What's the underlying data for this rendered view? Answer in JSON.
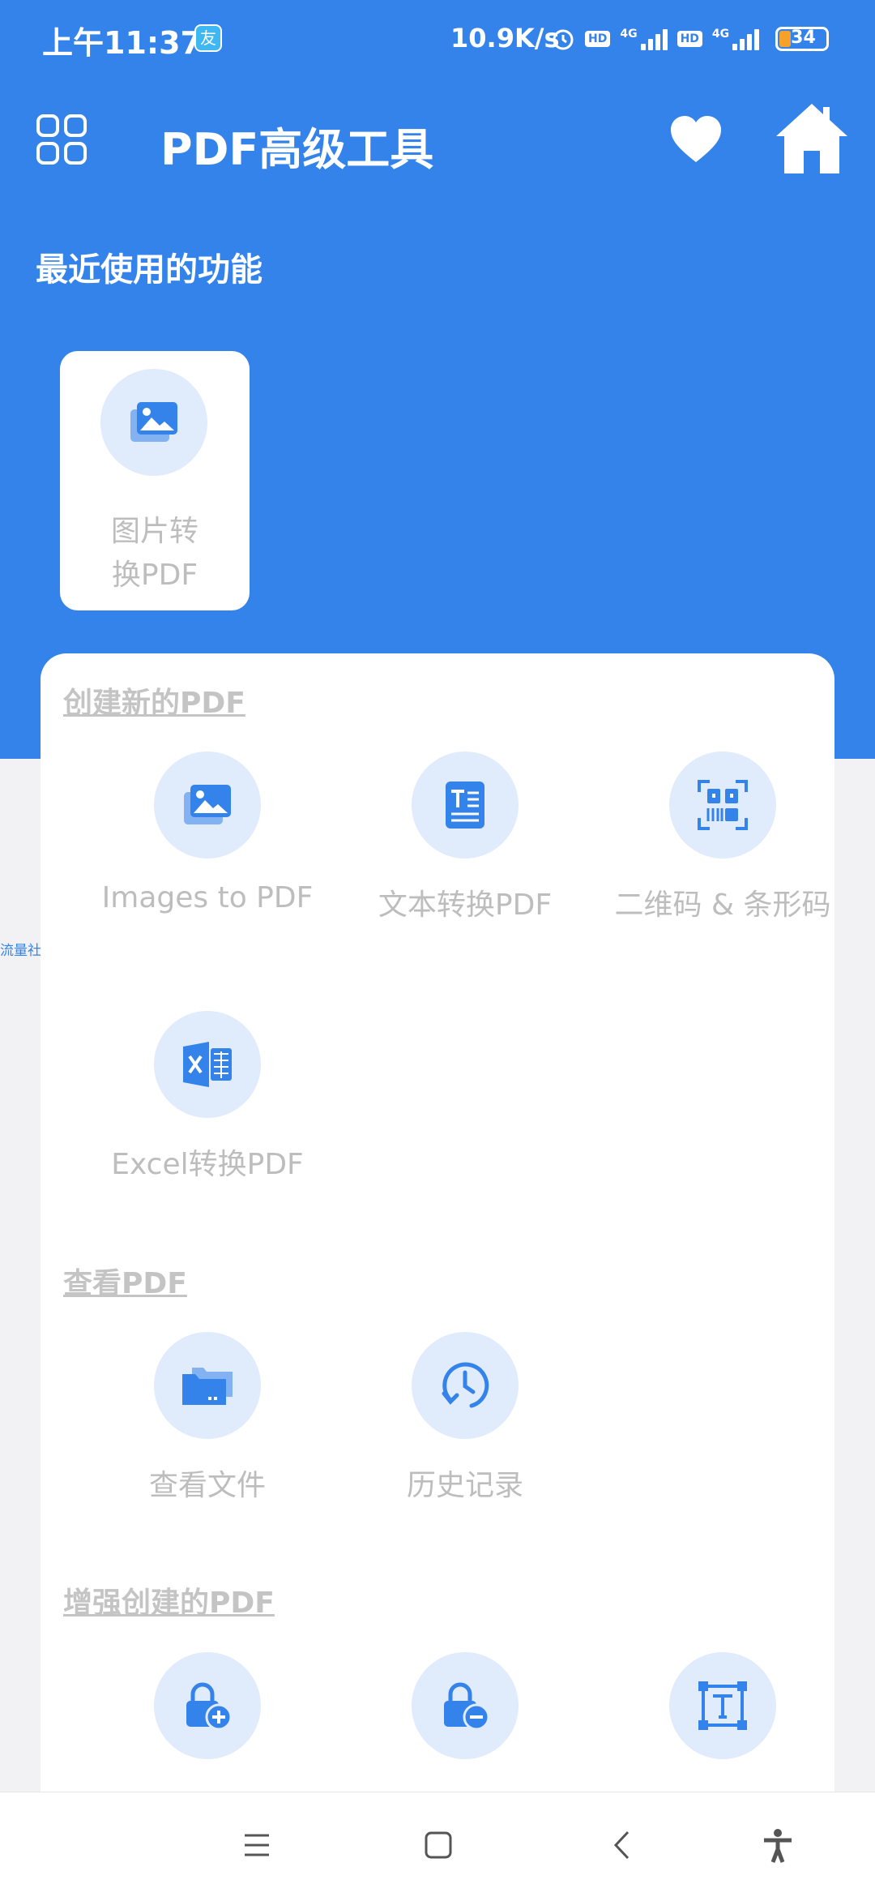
{
  "status_bar": {
    "time": "上午11:37",
    "app_badge": "友",
    "net_speed": "10.9K/s",
    "hd_label": "HD",
    "signal_label": "4G",
    "battery": "34"
  },
  "app_bar": {
    "title": "PDF高级工具",
    "menu_icon": "grid-icon",
    "favorite_icon": "heart-icon",
    "home_icon": "home-icon"
  },
  "recent": {
    "title": "最近使用的功能",
    "items": [
      {
        "label_line1": "图片转",
        "label_line2": "换PDF",
        "icon": "image-icon"
      }
    ]
  },
  "side_tag": "流量社区",
  "sections": [
    {
      "title": "创建新的PDF",
      "items": [
        {
          "label": "Images to PDF",
          "icon": "image-icon"
        },
        {
          "label": "文本转换PDF",
          "icon": "text-doc-icon"
        },
        {
          "label": "二维码 & 条形码",
          "icon": "qr-code-icon"
        },
        {
          "label": "Excel转换PDF",
          "icon": "excel-icon"
        }
      ]
    },
    {
      "title": "查看PDF",
      "items": [
        {
          "label": "查看文件",
          "icon": "folder-icon"
        },
        {
          "label": "历史记录",
          "icon": "history-icon"
        }
      ]
    },
    {
      "title": "增强创建的PDF",
      "items": [
        {
          "label": "",
          "icon": "lock-add-icon"
        },
        {
          "label": "",
          "icon": "lock-remove-icon"
        },
        {
          "label": "",
          "icon": "text-frame-icon"
        }
      ]
    }
  ],
  "colors": {
    "primary": "#3483ea",
    "icon_circle": "#e0ebfb",
    "label_gray": "#bdbdbd"
  }
}
